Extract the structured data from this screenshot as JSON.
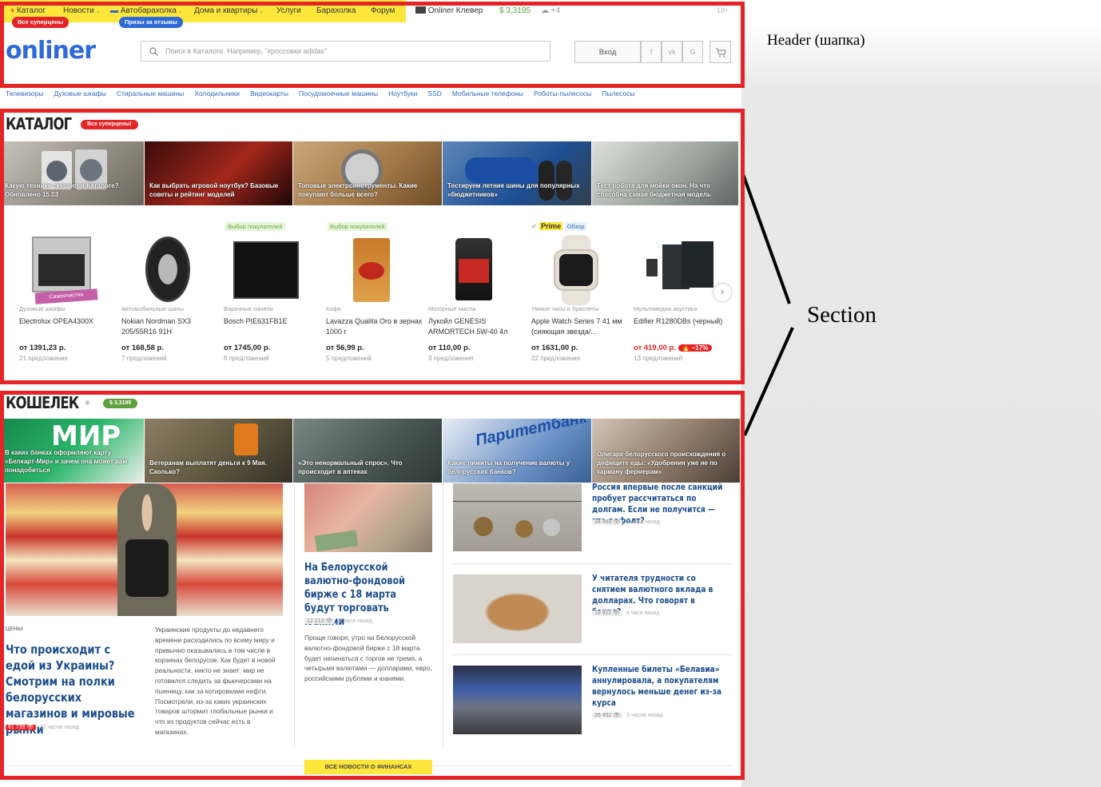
{
  "annotations": {
    "header": "Header (шапка)",
    "section": "Section"
  },
  "topnav": {
    "items": [
      "Каталог",
      "Новости",
      "Автобарахолка",
      "Дома и квартиры",
      "Услуги",
      "Барахолка",
      "Форум"
    ],
    "badge_catalog": "Все суперцены",
    "badge_auto": "Призы за отзывы",
    "clever": "Onliner Клевер",
    "rate": "$ 3,3195",
    "weather": "+4",
    "age": "18+"
  },
  "header": {
    "logo": "onliner",
    "search_placeholder": "Поиск в Каталоге. Например, \"кроссовки adidas\"",
    "login": "Вход",
    "social": [
      "f",
      "vk",
      "G"
    ]
  },
  "catlinks": [
    "Телевизоры",
    "Духовые шкафы",
    "Стиральные машины",
    "Холодильники",
    "Видеокарты",
    "Посудомоечные машины",
    "Ноутбуки",
    "SSD",
    "Мобильные телефоны",
    "Роботы-пылесосы",
    "Пылесосы"
  ],
  "catalog": {
    "title": "КАТАЛОГ",
    "badge": "Все суперцены!",
    "tiles": [
      "Какую технику скупают в Каталоге? Обновлено 15.03",
      "Как выбрать игровой ноутбук? Базовые советы и рейтинг моделей",
      "Топовые электроинструменты. Какие покупают больше всего?",
      "Тестируем летние шины для популярных «бюджетников»",
      "Тест робота для мойки окон. На что способна самая бюджетная модель"
    ],
    "choice_label": "Выбор покупателей",
    "prime_label": "Prime",
    "review_label": "Обзор",
    "self_clean_label": "Самоочистка",
    "products": [
      {
        "type": "Духовые шкафы",
        "name": "Electrolux OPEA4300X",
        "price": "от 1391,23 р.",
        "offers": "21 предложение",
        "choice": ""
      },
      {
        "type": "Автомобильные шины",
        "name": "Nokian Nordman SX3 205/55R16 91H",
        "price": "от 168,58 р.",
        "offers": "7 предложений",
        "choice": ""
      },
      {
        "type": "Варочные панели",
        "name": "Bosch PIE631FB1E",
        "price": "от 1745,00 р.",
        "offers": "8 предложений",
        "choice": "Выбор покупателей"
      },
      {
        "type": "Кофе",
        "name": "Lavazza Qualita Oro в зернах 1000 г",
        "price": "от 56,99 р.",
        "offers": "5 предложений",
        "choice": "Выбор покупателей"
      },
      {
        "type": "Моторные масла",
        "name": "Лукойл GENESIS ARMORTECH 5W-40 4л",
        "price": "от 110,00 р.",
        "offers": "3 предложения",
        "choice": ""
      },
      {
        "type": "Умные часы и браслеты",
        "name": "Apple Watch Series 7 41 мм (сияющая звезда/...",
        "price": "от 1631,00 р.",
        "offers": "22 предложения",
        "choice": ""
      },
      {
        "type": "Мультимедиа акустика",
        "name": "Edifier R1280DBs (черный)",
        "price": "от 419,00 р.",
        "offers": "13 предложений",
        "choice": "",
        "discount": "–17%"
      }
    ]
  },
  "wallet": {
    "title": "КОШЕЛЕК",
    "rate_badge": "$ 3,3195",
    "tiles": [
      "В каких банках оформляют карту «Белкарт-Мир» и зачем она может вам понадобиться",
      "Ветеранам выплатят деньги к 9 Мая. Сколько?",
      "«Это ненормальный спрос». Что происходит в аптеках",
      "Какие лимиты на получение валюты у белорусских банков?",
      "Олигарх белорусского происхождения о дефиците еды: «Удобрения уже не по карману фермерам»"
    ],
    "main": {
      "rubric": "ЦЕНЫ",
      "title": "Что происходит с едой из Украины? Смотрим на полки белорусских магазинов и мировые рынки",
      "views": "61 739",
      "time": "11 часов назад",
      "text": "Украинские продукты до недавнего времени расходились по всему миру и привычно оказывались в том числе в корзинах белорусов. Как будет в новой реальности, никто не знает: мир не готовился следить за фьючерсами на пшеницу, как за котировками нефти. Посмотрели, из-за каких украинских товаров штормит глобальные рынки и что из продуктов сейчас есть в магазинах."
    },
    "middle": {
      "title": "На Белорусской валютно-фондовой бирже с 18 марта будут торговать юанями",
      "views": "12 213",
      "time": "3 часа назад",
      "text": "Проще говоря, утро на Белорусской валютно-фондовой бирже с 18 марта будет начинаться с торгов не тремя, а четырьмя валютами — долларами, евро, российскими рублями и юанями."
    },
    "side": [
      {
        "title": "Россия впервые после санкций пробует рассчитаться по долгам. Если не получится — это дефолт?",
        "views": "34 469",
        "time": "3 часа назад"
      },
      {
        "title": "У читателя трудности со снятием валютного вклада в долларах. Что говорят в банке?",
        "views": "19 911",
        "time": "4 часа назад"
      },
      {
        "title": "Купленные билеты «Белавиа» аннулировала, а покупателям вернулось меньше денег из-за курса",
        "views": "26 452",
        "time": "5 часов назад"
      }
    ],
    "all_news": "ВСЕ НОВОСТИ О ФИНАНСАХ"
  }
}
